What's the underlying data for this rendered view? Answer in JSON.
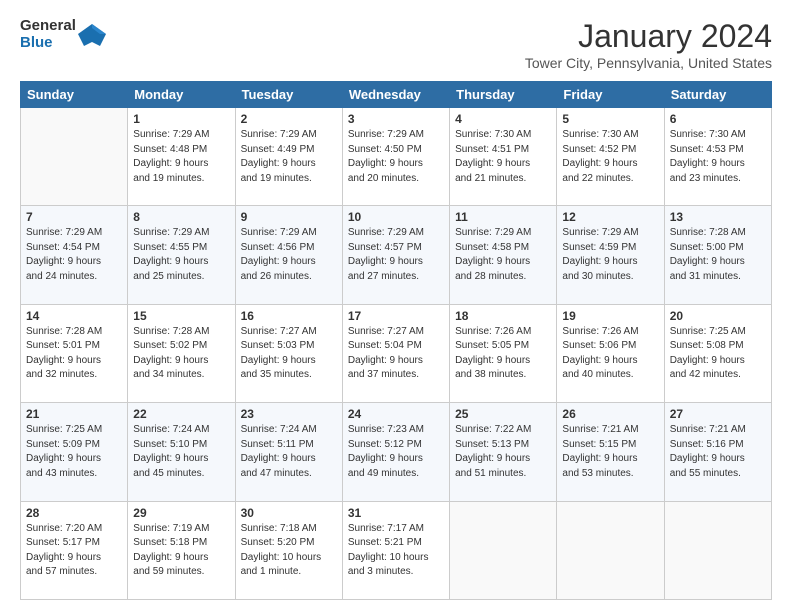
{
  "header": {
    "logo_line1": "General",
    "logo_line2": "Blue",
    "month": "January 2024",
    "location": "Tower City, Pennsylvania, United States"
  },
  "weekdays": [
    "Sunday",
    "Monday",
    "Tuesday",
    "Wednesday",
    "Thursday",
    "Friday",
    "Saturday"
  ],
  "weeks": [
    [
      {
        "day": "",
        "info": ""
      },
      {
        "day": "1",
        "info": "Sunrise: 7:29 AM\nSunset: 4:48 PM\nDaylight: 9 hours\nand 19 minutes."
      },
      {
        "day": "2",
        "info": "Sunrise: 7:29 AM\nSunset: 4:49 PM\nDaylight: 9 hours\nand 19 minutes."
      },
      {
        "day": "3",
        "info": "Sunrise: 7:29 AM\nSunset: 4:50 PM\nDaylight: 9 hours\nand 20 minutes."
      },
      {
        "day": "4",
        "info": "Sunrise: 7:30 AM\nSunset: 4:51 PM\nDaylight: 9 hours\nand 21 minutes."
      },
      {
        "day": "5",
        "info": "Sunrise: 7:30 AM\nSunset: 4:52 PM\nDaylight: 9 hours\nand 22 minutes."
      },
      {
        "day": "6",
        "info": "Sunrise: 7:30 AM\nSunset: 4:53 PM\nDaylight: 9 hours\nand 23 minutes."
      }
    ],
    [
      {
        "day": "7",
        "info": "Sunrise: 7:29 AM\nSunset: 4:54 PM\nDaylight: 9 hours\nand 24 minutes."
      },
      {
        "day": "8",
        "info": "Sunrise: 7:29 AM\nSunset: 4:55 PM\nDaylight: 9 hours\nand 25 minutes."
      },
      {
        "day": "9",
        "info": "Sunrise: 7:29 AM\nSunset: 4:56 PM\nDaylight: 9 hours\nand 26 minutes."
      },
      {
        "day": "10",
        "info": "Sunrise: 7:29 AM\nSunset: 4:57 PM\nDaylight: 9 hours\nand 27 minutes."
      },
      {
        "day": "11",
        "info": "Sunrise: 7:29 AM\nSunset: 4:58 PM\nDaylight: 9 hours\nand 28 minutes."
      },
      {
        "day": "12",
        "info": "Sunrise: 7:29 AM\nSunset: 4:59 PM\nDaylight: 9 hours\nand 30 minutes."
      },
      {
        "day": "13",
        "info": "Sunrise: 7:28 AM\nSunset: 5:00 PM\nDaylight: 9 hours\nand 31 minutes."
      }
    ],
    [
      {
        "day": "14",
        "info": "Sunrise: 7:28 AM\nSunset: 5:01 PM\nDaylight: 9 hours\nand 32 minutes."
      },
      {
        "day": "15",
        "info": "Sunrise: 7:28 AM\nSunset: 5:02 PM\nDaylight: 9 hours\nand 34 minutes."
      },
      {
        "day": "16",
        "info": "Sunrise: 7:27 AM\nSunset: 5:03 PM\nDaylight: 9 hours\nand 35 minutes."
      },
      {
        "day": "17",
        "info": "Sunrise: 7:27 AM\nSunset: 5:04 PM\nDaylight: 9 hours\nand 37 minutes."
      },
      {
        "day": "18",
        "info": "Sunrise: 7:26 AM\nSunset: 5:05 PM\nDaylight: 9 hours\nand 38 minutes."
      },
      {
        "day": "19",
        "info": "Sunrise: 7:26 AM\nSunset: 5:06 PM\nDaylight: 9 hours\nand 40 minutes."
      },
      {
        "day": "20",
        "info": "Sunrise: 7:25 AM\nSunset: 5:08 PM\nDaylight: 9 hours\nand 42 minutes."
      }
    ],
    [
      {
        "day": "21",
        "info": "Sunrise: 7:25 AM\nSunset: 5:09 PM\nDaylight: 9 hours\nand 43 minutes."
      },
      {
        "day": "22",
        "info": "Sunrise: 7:24 AM\nSunset: 5:10 PM\nDaylight: 9 hours\nand 45 minutes."
      },
      {
        "day": "23",
        "info": "Sunrise: 7:24 AM\nSunset: 5:11 PM\nDaylight: 9 hours\nand 47 minutes."
      },
      {
        "day": "24",
        "info": "Sunrise: 7:23 AM\nSunset: 5:12 PM\nDaylight: 9 hours\nand 49 minutes."
      },
      {
        "day": "25",
        "info": "Sunrise: 7:22 AM\nSunset: 5:13 PM\nDaylight: 9 hours\nand 51 minutes."
      },
      {
        "day": "26",
        "info": "Sunrise: 7:21 AM\nSunset: 5:15 PM\nDaylight: 9 hours\nand 53 minutes."
      },
      {
        "day": "27",
        "info": "Sunrise: 7:21 AM\nSunset: 5:16 PM\nDaylight: 9 hours\nand 55 minutes."
      }
    ],
    [
      {
        "day": "28",
        "info": "Sunrise: 7:20 AM\nSunset: 5:17 PM\nDaylight: 9 hours\nand 57 minutes."
      },
      {
        "day": "29",
        "info": "Sunrise: 7:19 AM\nSunset: 5:18 PM\nDaylight: 9 hours\nand 59 minutes."
      },
      {
        "day": "30",
        "info": "Sunrise: 7:18 AM\nSunset: 5:20 PM\nDaylight: 10 hours\nand 1 minute."
      },
      {
        "day": "31",
        "info": "Sunrise: 7:17 AM\nSunset: 5:21 PM\nDaylight: 10 hours\nand 3 minutes."
      },
      {
        "day": "",
        "info": ""
      },
      {
        "day": "",
        "info": ""
      },
      {
        "day": "",
        "info": ""
      }
    ]
  ]
}
